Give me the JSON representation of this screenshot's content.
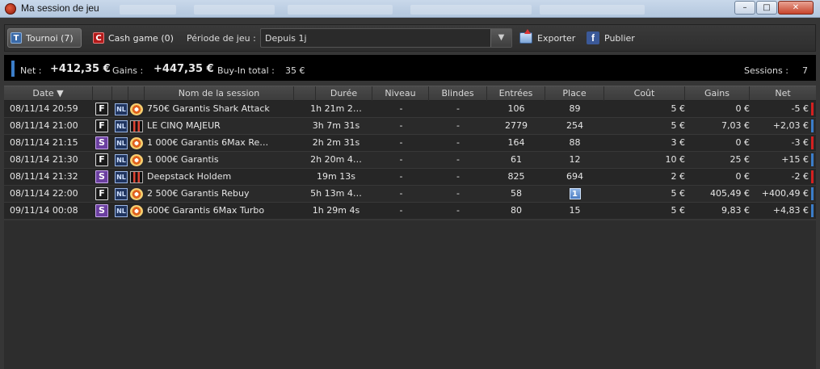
{
  "window": {
    "title": "Ma session de jeu",
    "min": "–",
    "max": "□",
    "close": "✕"
  },
  "toolbar": {
    "tab_tournoi": {
      "badge": "T",
      "label": "Tournoi (7)"
    },
    "tab_cash": {
      "badge": "C",
      "label": "Cash game (0)"
    },
    "period_label": "Période de jeu :",
    "period_value": "Depuis 1j",
    "period_arrow": "▼",
    "export_label": "Exporter",
    "publish_label": "Publier",
    "facebook_glyph": "f"
  },
  "summary": {
    "net_label": "Net :",
    "net_value": "+412,35 €",
    "gains_label": "Gains :",
    "gains_value": "+447,35 €",
    "buyin_label": "Buy-In total :",
    "buyin_value": "35 €",
    "sessions_label": "Sessions :",
    "sessions_value": "7"
  },
  "table": {
    "headers": {
      "date": "Date ▼",
      "name": "Nom de la session",
      "duration": "Durée",
      "level": "Niveau",
      "blinds": "Blindes",
      "entries": "Entrées",
      "place": "Place",
      "cost": "Coût",
      "gains": "Gains",
      "net": "Net"
    },
    "rows": [
      {
        "date": "08/11/14 20:59",
        "type": "F",
        "nl": "NL",
        "room": "chip",
        "name": "750€ Garantis Shark Attack",
        "duration": "1h 21m 2…",
        "level": "-",
        "blinds": "-",
        "entries": "106",
        "place": "89",
        "cost": "5 €",
        "gains": "0 €",
        "net": "-5 €",
        "indicator": "#d42020"
      },
      {
        "date": "08/11/14 21:00",
        "type": "F",
        "nl": "NL",
        "room": "w",
        "name": "LE CINQ MAJEUR",
        "duration": "3h 7m 31s",
        "level": "-",
        "blinds": "-",
        "entries": "2779",
        "place": "254",
        "cost": "5 €",
        "gains": "7,03 €",
        "net": "+2,03 €",
        "indicator": "#3b7dc9"
      },
      {
        "date": "08/11/14 21:15",
        "type": "S",
        "nl": "NL",
        "room": "chip",
        "name": "1 000€ Garantis 6Max Re…",
        "duration": "2h 2m 31s",
        "level": "-",
        "blinds": "-",
        "entries": "164",
        "place": "88",
        "cost": "3 €",
        "gains": "0 €",
        "net": "-3 €",
        "indicator": "#d42020"
      },
      {
        "date": "08/11/14 21:30",
        "type": "F",
        "nl": "NL",
        "room": "chip",
        "name": "1 000€ Garantis",
        "duration": "2h 20m 4…",
        "level": "-",
        "blinds": "-",
        "entries": "61",
        "place": "12",
        "cost": "10 €",
        "gains": "25 €",
        "net": "+15 €",
        "indicator": "#3b7dc9"
      },
      {
        "date": "08/11/14 21:32",
        "type": "S",
        "nl": "NL",
        "room": "w",
        "name": "Deepstack Holdem",
        "duration": "19m 13s",
        "level": "-",
        "blinds": "-",
        "entries": "825",
        "place": "694",
        "cost": "2 €",
        "gains": "0 €",
        "net": "-2 €",
        "indicator": "#d42020"
      },
      {
        "date": "08/11/14 22:00",
        "type": "F",
        "nl": "NL",
        "room": "chip",
        "name": "2 500€ Garantis Rebuy",
        "duration": "5h 13m 4…",
        "level": "-",
        "blinds": "-",
        "entries": "58",
        "place": "1",
        "cost": "5 €",
        "gains": "405,49 €",
        "net": "+400,49 €",
        "indicator": "#3b7dc9"
      },
      {
        "date": "09/11/14 00:08",
        "type": "S",
        "nl": "NL",
        "room": "chip",
        "name": "600€ Garantis 6Max Turbo",
        "duration": "1h 29m 4s",
        "level": "-",
        "blinds": "-",
        "entries": "80",
        "place": "15",
        "cost": "5 €",
        "gains": "9,83 €",
        "net": "+4,83 €",
        "indicator": "#3b7dc9"
      }
    ]
  }
}
